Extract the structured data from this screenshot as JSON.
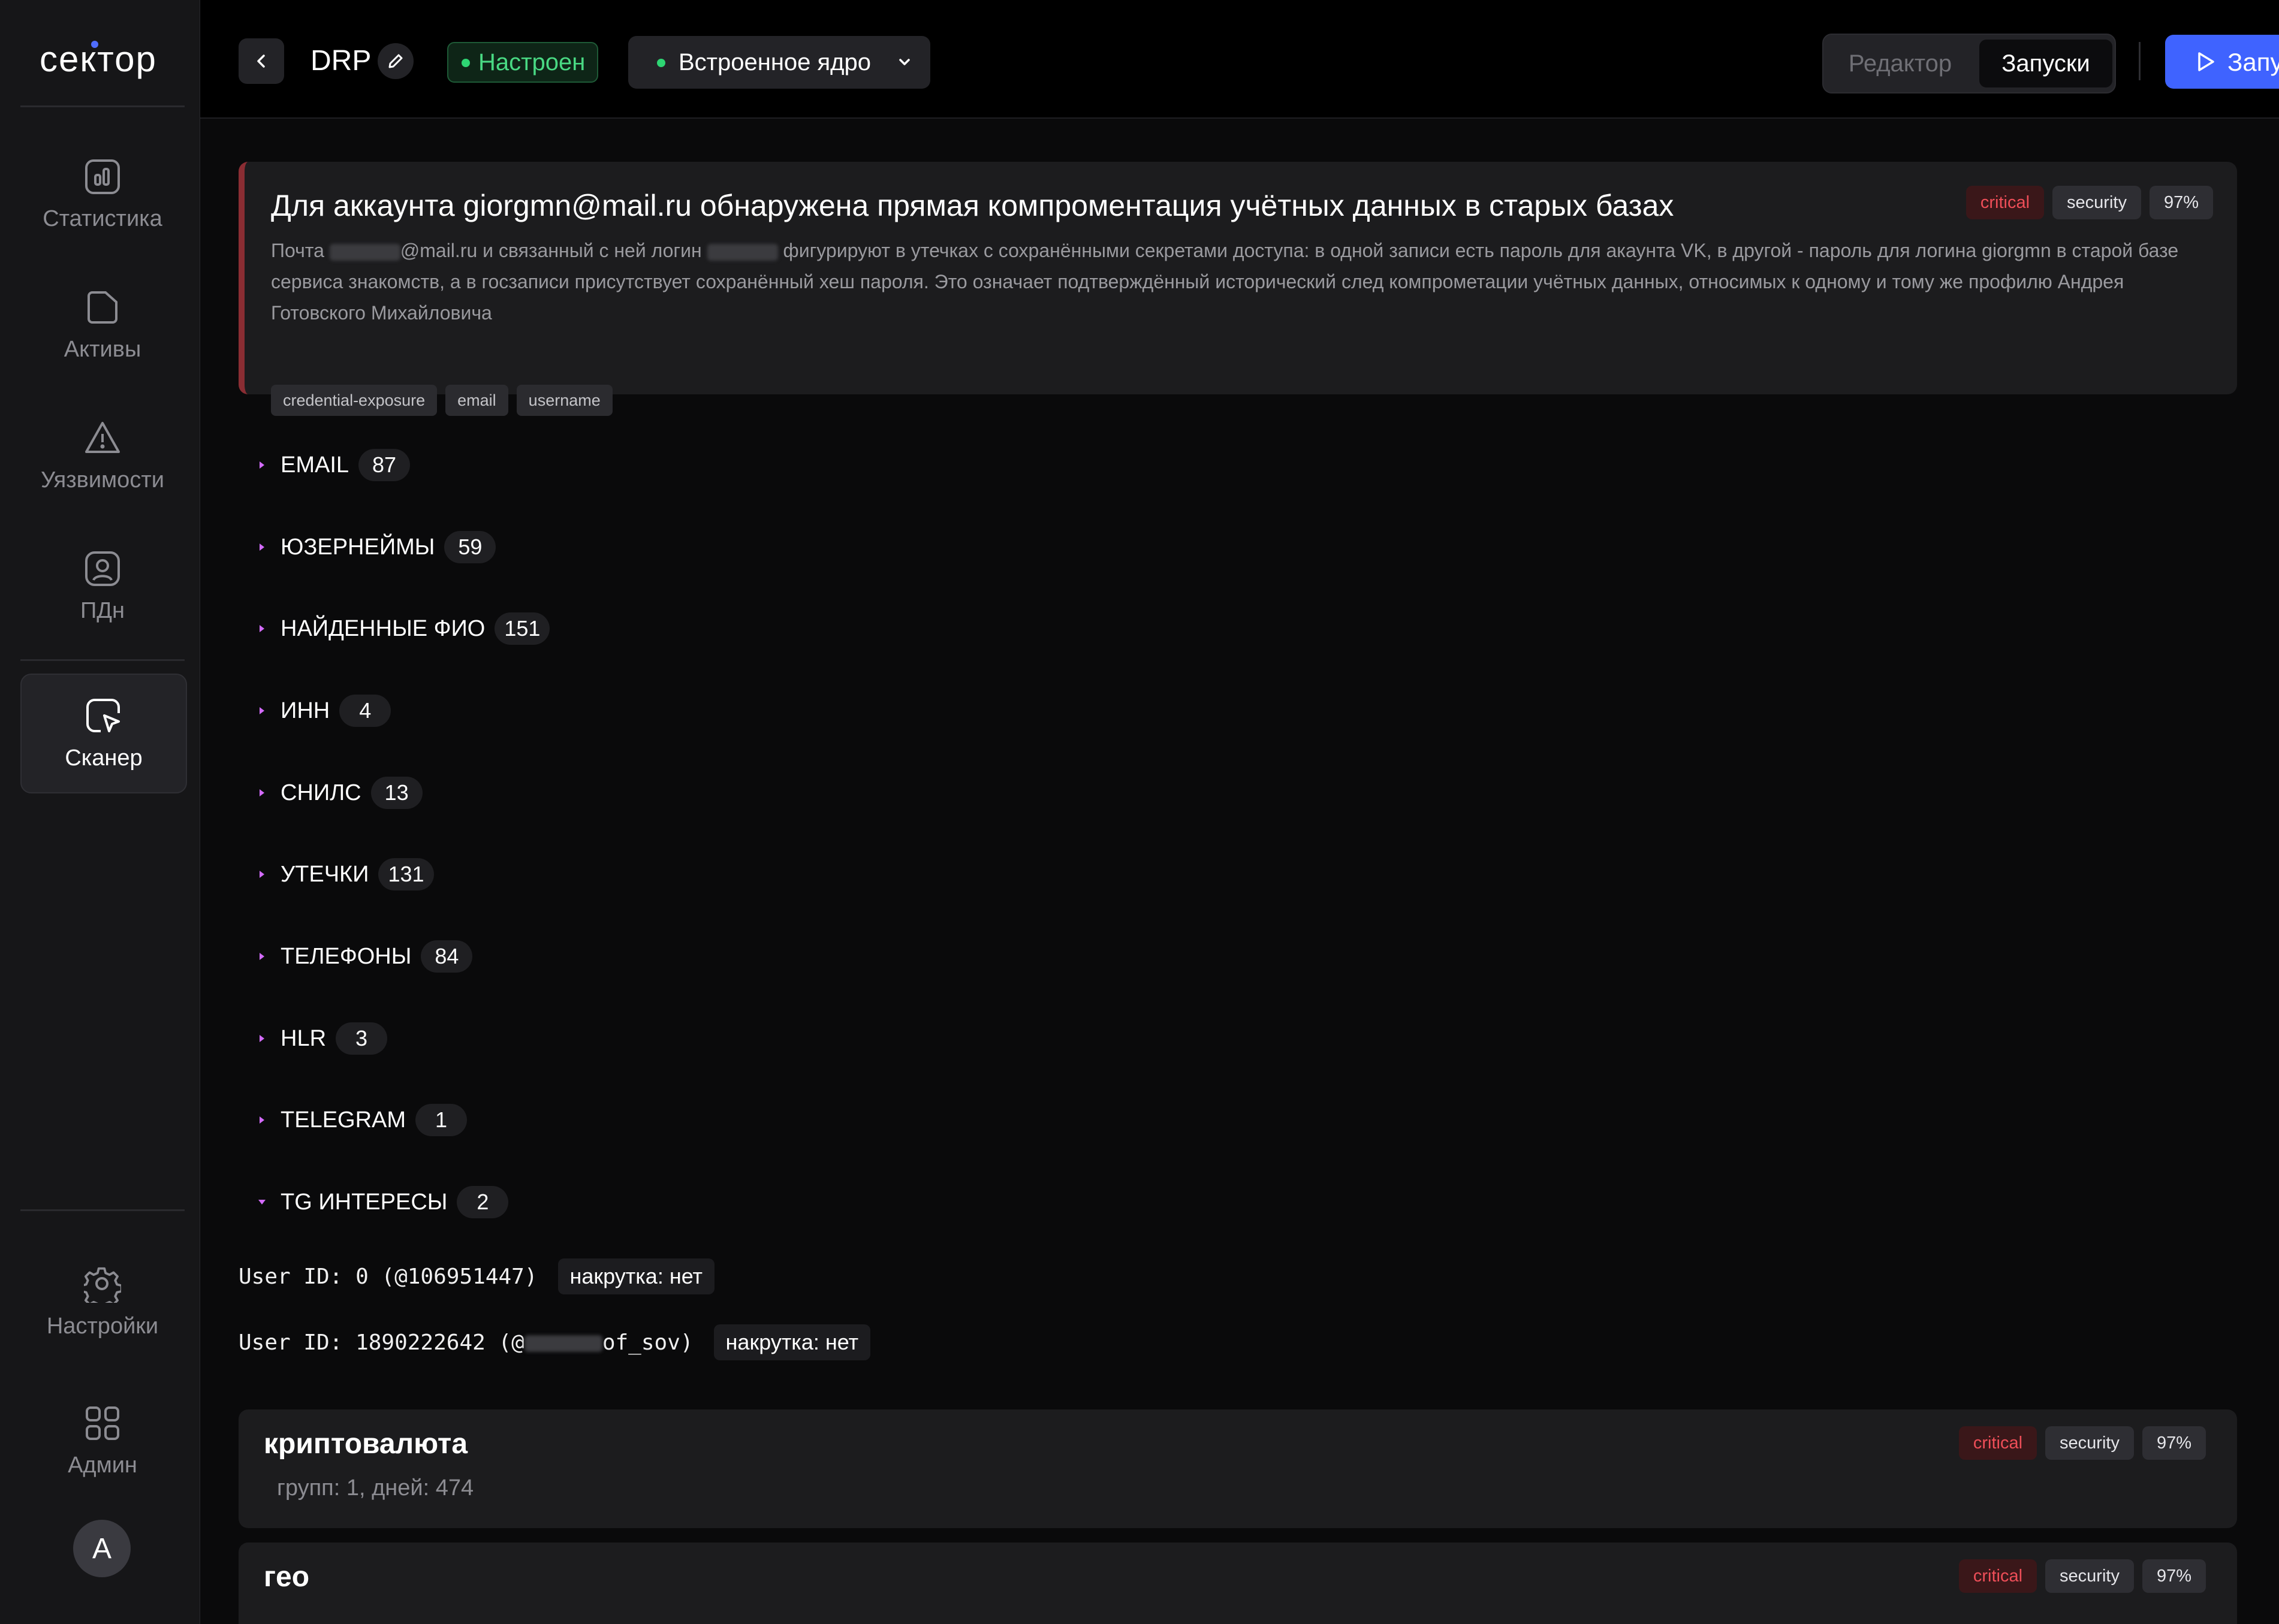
{
  "brand": {
    "logo_text": "сектор"
  },
  "sidebar": {
    "items": [
      {
        "label": "Статистика",
        "icon": "chart-icon"
      },
      {
        "label": "Активы",
        "icon": "folder-icon"
      },
      {
        "label": "Уязвимости",
        "icon": "warning-icon"
      },
      {
        "label": "ПДн",
        "icon": "user-card-icon"
      },
      {
        "label": "Сканер",
        "icon": "scanner-icon",
        "active": true
      }
    ],
    "bottom": [
      {
        "label": "Настройки",
        "icon": "gear-icon"
      },
      {
        "label": "Админ",
        "icon": "grid-icon"
      }
    ],
    "avatar_letter": "A"
  },
  "header": {
    "title": "DRP",
    "status": "Настроен",
    "core": "Встроенное ядро",
    "tabs": [
      "Редактор",
      "Запуски"
    ],
    "active_tab": "Запуски",
    "run_label": "Запустить"
  },
  "alert": {
    "title": "Для аккаунта giorgmn@mail.ru  обнаружена прямая компроментация учётных данных в старых базах",
    "desc_part1": "Почта ",
    "desc_part2": "@mail.ru и связанный с ней логин ",
    "desc_part3": " фигурируют в утечках с сохранёнными секретами доступа: в одной записи есть пароль для акаунта VK, в другой - пароль для логина giorgmn в старой базе сервиса знакомств, а в госзаписи присутствует сохранённый хеш пароля. Это означает подтверждённый исторический след компрометации учётных данных, относимых к одному и тому же профилю Андрея Готовского Михайловича",
    "tags": [
      "credential-exposure",
      "email",
      "username"
    ],
    "badges": {
      "severity": "critical",
      "category": "security",
      "confidence": "97%"
    }
  },
  "sections": [
    {
      "name": "EMAIL",
      "count": "87",
      "expanded": false
    },
    {
      "name": "ЮЗЕРНЕЙМЫ",
      "count": "59",
      "expanded": false
    },
    {
      "name": "НАЙДЕННЫЕ ФИО",
      "count": "151",
      "expanded": false
    },
    {
      "name": "ИНН",
      "count": "4",
      "expanded": false
    },
    {
      "name": "СНИЛС",
      "count": "13",
      "expanded": false
    },
    {
      "name": "УТЕЧКИ",
      "count": "131",
      "expanded": false
    },
    {
      "name": "ТЕЛЕФОНЫ",
      "count": "84",
      "expanded": false
    },
    {
      "name": "HLR",
      "count": "3",
      "expanded": false
    },
    {
      "name": "TELEGRAM",
      "count": "1",
      "expanded": false
    },
    {
      "name": "TG ИНТЕРЕСЫ",
      "count": "2",
      "expanded": true
    }
  ],
  "tg_entries": [
    {
      "code": "User ID: 0 (@106951447)",
      "flag": "накрутка: нет"
    },
    {
      "code_prefix": "User ID: 1890222642 (@",
      "code_suffix": "of_sov)",
      "flag": "накрутка: нет"
    }
  ],
  "cards": [
    {
      "title": "криптовалюта",
      "sub": "групп: 1, дней: 474",
      "severity": "critical",
      "category": "security",
      "confidence": "97%"
    },
    {
      "title": "гео",
      "sub": "",
      "severity": "critical",
      "category": "security",
      "confidence": "97%"
    }
  ],
  "colors": {
    "accent": "#3f63ff",
    "critical": "#ee4e58",
    "success": "#2ed573"
  }
}
